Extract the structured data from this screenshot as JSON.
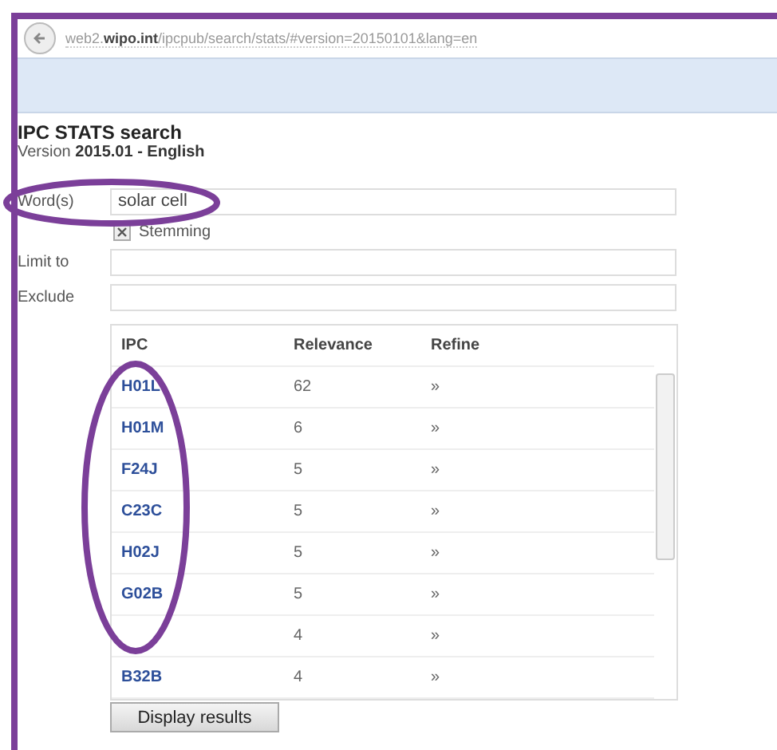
{
  "address_bar": {
    "url": "web2.**wipo.int**/ipcpub/search/stats/#version=20150101&lang=en"
  },
  "page": {
    "title": "IPC STATS search",
    "version_label": "Version ",
    "version": "2015.01 - English"
  },
  "form": {
    "words": {
      "label": "Word(s)",
      "value": "solar cell"
    },
    "stemming": {
      "label": "Stemming",
      "checked": true
    },
    "limit_to": {
      "label": "Limit to"
    },
    "exclude": {
      "label": "Exclude"
    }
  },
  "table": {
    "columns": [
      "IPC",
      "Relevance",
      "Refine"
    ],
    "rows": [
      {
        "ipc": "H01L",
        "relevance": "62",
        "refine": "»"
      },
      {
        "ipc": "H01M",
        "relevance": "6",
        "refine": "»"
      },
      {
        "ipc": "F24J",
        "relevance": "5",
        "refine": "»"
      },
      {
        "ipc": "C23C",
        "relevance": "5",
        "refine": "»"
      },
      {
        "ipc": "H02J",
        "relevance": "5",
        "refine": "»"
      },
      {
        "ipc": "G02B",
        "relevance": "5",
        "refine": "»"
      },
      {
        "relevance": "4",
        "refine": "»"
      },
      {
        "ipc": "B32B",
        "relevance": "4",
        "refine": "»"
      }
    ]
  },
  "button": {
    "label": "Display results"
  }
}
